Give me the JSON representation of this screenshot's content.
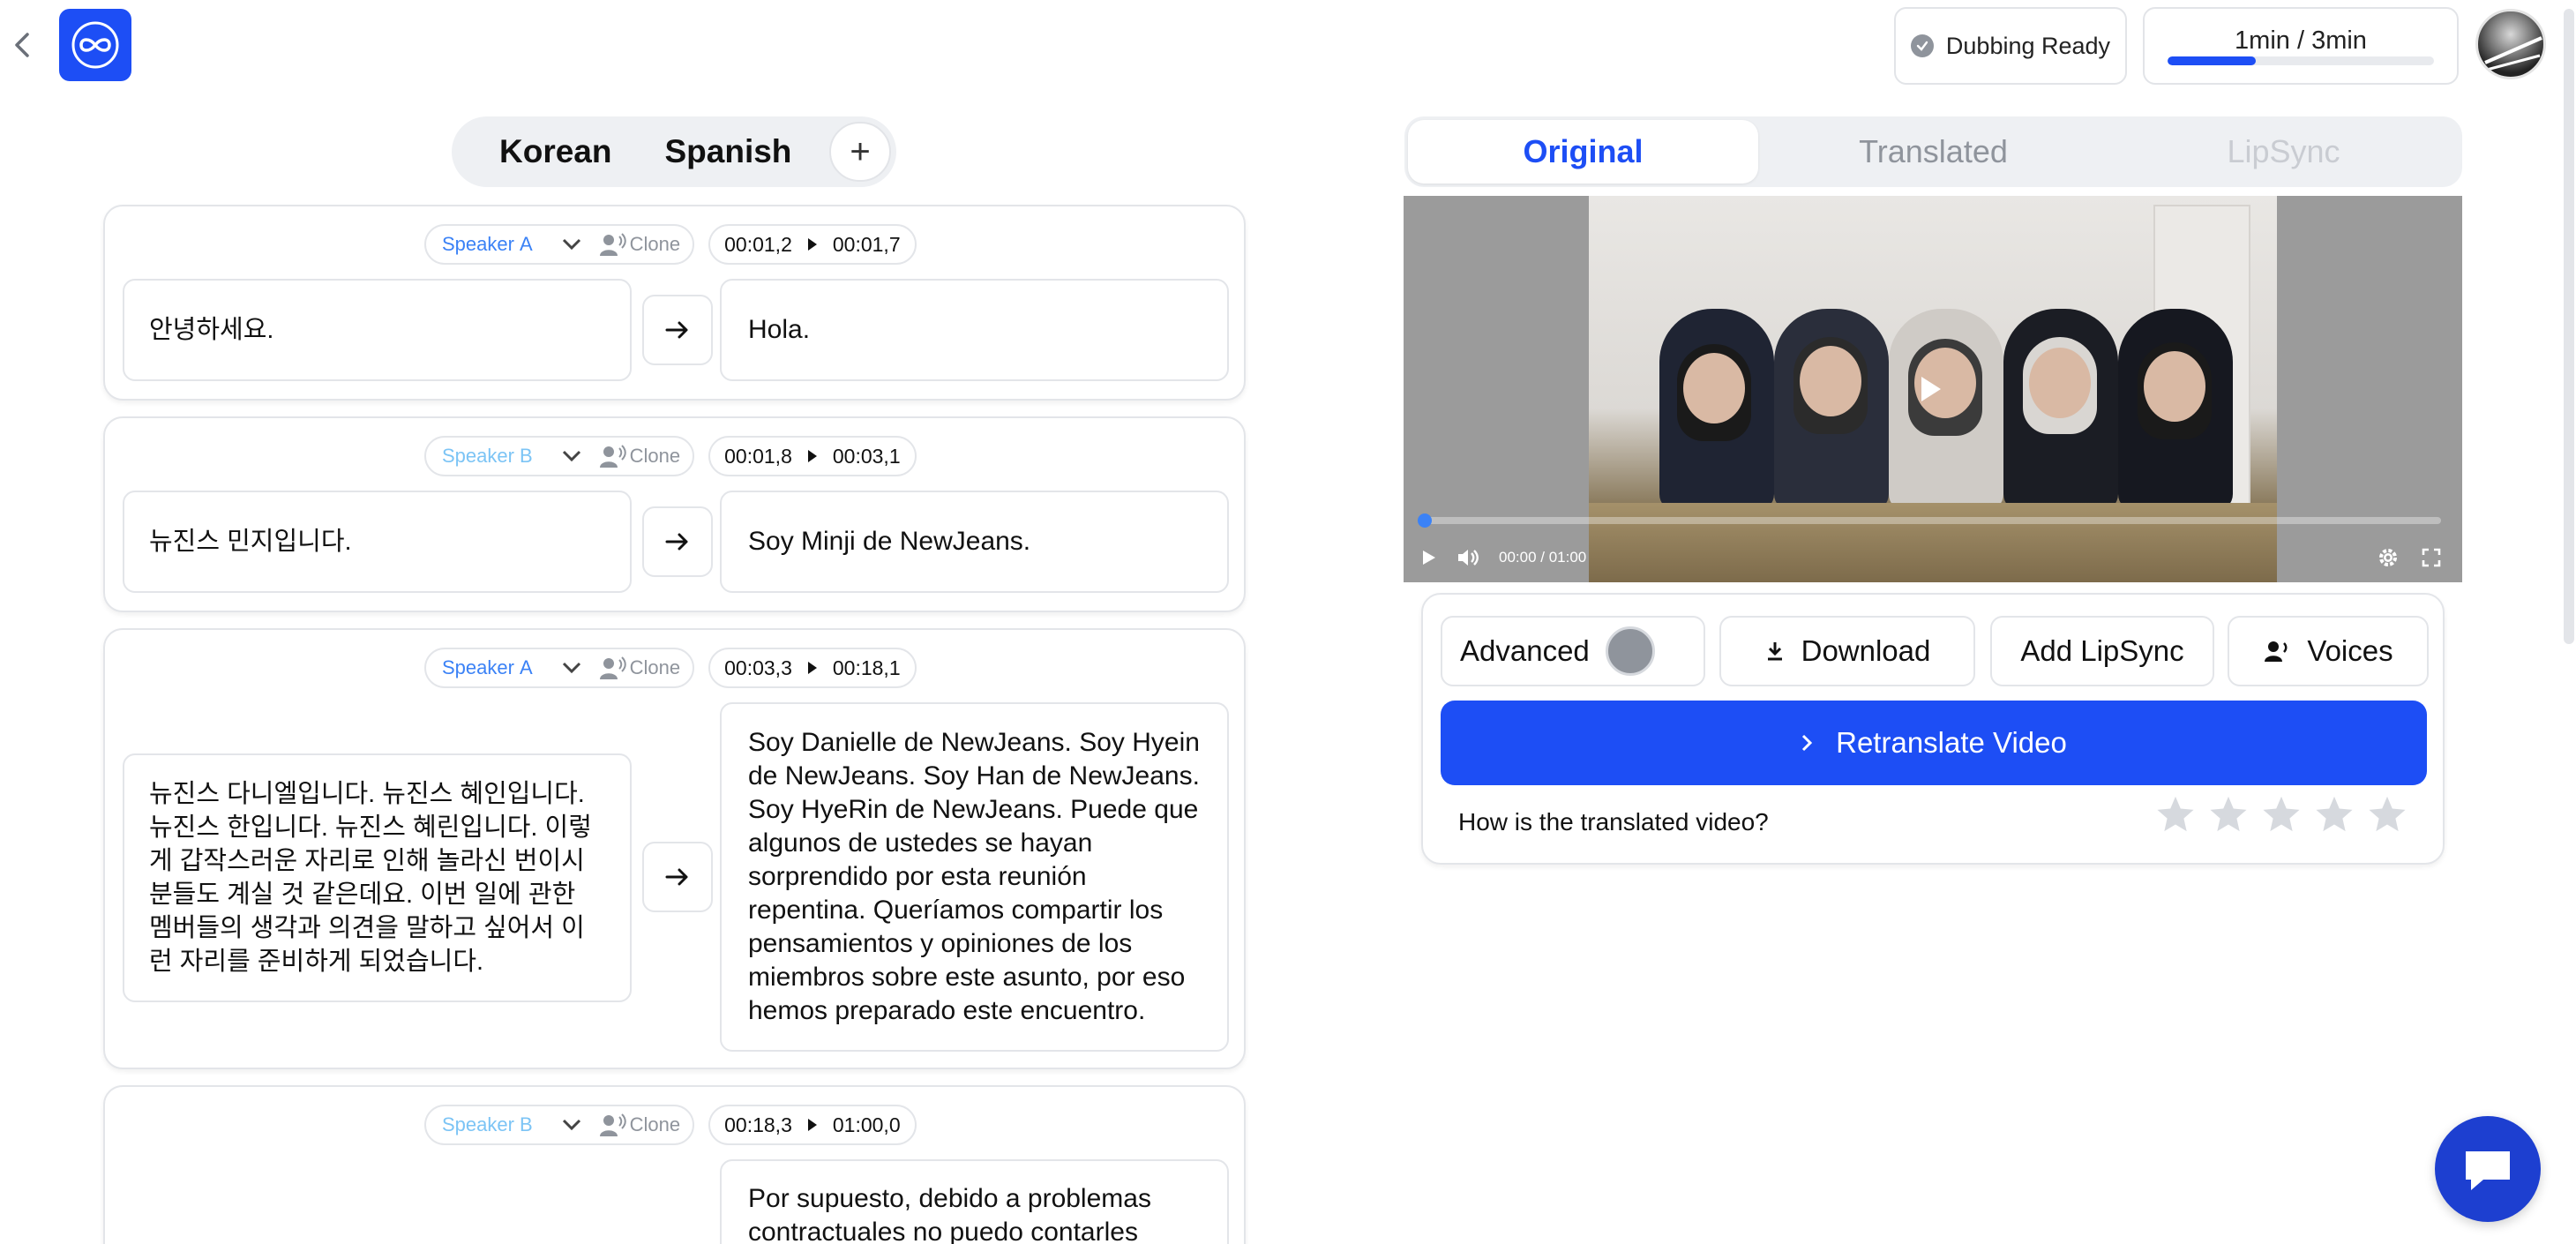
{
  "header": {
    "status_label": "Dubbing Ready",
    "usage_label": "1min / 3min",
    "usage_fraction": 0.33
  },
  "languages": {
    "tabs": [
      {
        "label": "Korean"
      },
      {
        "label": "Spanish"
      }
    ],
    "add_label": "+"
  },
  "segments": [
    {
      "speaker": "Speaker",
      "speaker_letter": "A",
      "clone_label": "Clone",
      "start": "00:01,2",
      "end": "00:01,7",
      "source": "안녕하세요.",
      "target": "Hola."
    },
    {
      "speaker": "Speaker",
      "speaker_letter": "B",
      "clone_label": "Clone",
      "start": "00:01,8",
      "end": "00:03,1",
      "source": "뉴진스 민지입니다.",
      "target": "Soy Minji de NewJeans."
    },
    {
      "speaker": "Speaker",
      "speaker_letter": "A",
      "clone_label": "Clone",
      "start": "00:03,3",
      "end": "00:18,1",
      "source": "뉴진스 다니엘입니다. 뉴진스 혜인입니다. 뉴진스 한입니다. 뉴진스 혜린입니다. 이렇게 갑작스러운 자리로 인해 놀라신 번이시 분들도 계실 것 같은데요. 이번 일에 관한 멤버들의 생각과 의견을 말하고 싶어서 이런 자리를 준비하게 되었습니다.",
      "target": "Soy Danielle de NewJeans. Soy Hyein de NewJeans. Soy Han de NewJeans. Soy HyeRin de NewJeans. Puede que algunos de ustedes se hayan sorprendido por esta reunión repentina. Queríamos compartir los pensamientos y opiniones de los miembros sobre este asunto, por eso hemos preparado este encuentro."
    },
    {
      "speaker": "Speaker",
      "speaker_letter": "B",
      "clone_label": "Clone",
      "start": "00:18,3",
      "end": "01:00,0",
      "source": "",
      "target": "Por supuesto, debido a problemas contractuales no puedo contarles"
    }
  ],
  "view_tabs": [
    {
      "label": "Original",
      "state": "active"
    },
    {
      "label": "Translated",
      "state": "inactive"
    },
    {
      "label": "LipSync",
      "state": "disabled"
    }
  ],
  "video": {
    "time_display": "00:00 / 01:00",
    "progress_fraction": 0.0
  },
  "actions": {
    "advanced_label": "Advanced",
    "download_label": "Download",
    "add_lipsync_label": "Add LipSync",
    "voices_label": "Voices",
    "retranslate_label": "Retranslate Video",
    "rating_question": "How is the translated video?",
    "rating_max": 5,
    "rating_value": 0
  },
  "colors": {
    "accent": "#1d4ef5",
    "speaker_a": "#3b82f6",
    "speaker_b": "#7cc4f5",
    "muted": "#8f949c",
    "star_empty": "#d6d9de"
  },
  "icons": {
    "back": "chevron-left-icon",
    "logo": "infinity-logo-icon",
    "status": "check-circle-icon",
    "clone": "voice-clone-icon",
    "translate": "arrow-right-icon",
    "download": "download-icon",
    "voices": "voices-icon",
    "retranslate": "chevron-right-icon",
    "chat": "chat-icon"
  }
}
